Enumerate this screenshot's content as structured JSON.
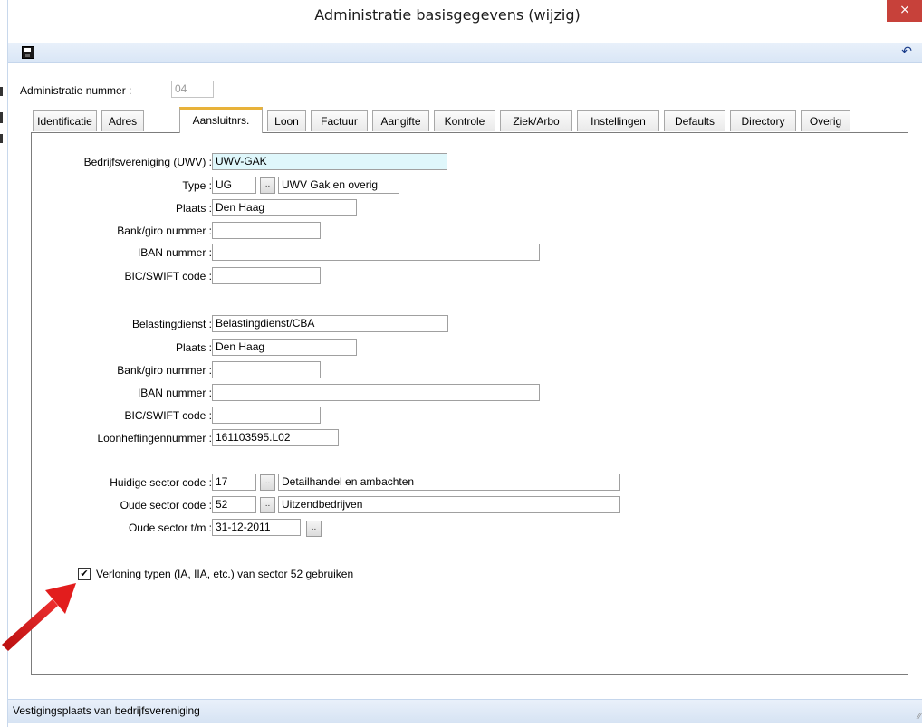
{
  "window": {
    "title": "Administratie basisgegevens  (wijzig)",
    "close_glyph": "×"
  },
  "toolbar": {
    "save_icon": "save-icon",
    "undo_icon": "undo-icon",
    "undo_glyph": "↶"
  },
  "admin": {
    "label": "Administratie nummer :",
    "value": "04"
  },
  "tabs": [
    {
      "label": "Identificatie"
    },
    {
      "label": "Adres"
    },
    {
      "label": "Aansluitnrs."
    },
    {
      "label": "Loon"
    },
    {
      "label": "Factuur"
    },
    {
      "label": "Aangifte"
    },
    {
      "label": "Kontrole"
    },
    {
      "label": "Ziek/Arbo"
    },
    {
      "label": "Instellingen"
    },
    {
      "label": "Defaults"
    },
    {
      "label": "Directory"
    },
    {
      "label": "Overig"
    }
  ],
  "active_tab": "Aansluitnrs.",
  "uwv": {
    "bedrijfsvereniging": {
      "label": "Bedrijfsvereniging (UWV) :",
      "value": "UWV-GAK"
    },
    "type": {
      "label": "Type :",
      "code": "UG",
      "description": "UWV Gak en overig"
    },
    "plaats": {
      "label": "Plaats :",
      "value": "Den Haag"
    },
    "bank": {
      "label": "Bank/giro nummer :",
      "value": ""
    },
    "iban": {
      "label": "IBAN nummer :",
      "value": ""
    },
    "bic": {
      "label": "BIC/SWIFT code :",
      "value": ""
    }
  },
  "belasting": {
    "dienst": {
      "label": "Belastingdienst :",
      "value": "Belastingdienst/CBA"
    },
    "plaats": {
      "label": "Plaats :",
      "value": "Den Haag"
    },
    "bank": {
      "label": "Bank/giro nummer :",
      "value": ""
    },
    "iban": {
      "label": "IBAN nummer :",
      "value": ""
    },
    "bic": {
      "label": "BIC/SWIFT code :",
      "value": ""
    },
    "loonheffing": {
      "label": "Loonheffingennummer :",
      "value": "161103595.L02"
    }
  },
  "sector": {
    "huidige": {
      "label": "Huidige sector code :",
      "code": "17",
      "description": "Detailhandel en ambachten"
    },
    "oude": {
      "label": "Oude sector code :",
      "code": "52",
      "description": "Uitzendbedrijven"
    },
    "tm": {
      "label": "Oude sector t/m :",
      "value": "31-12-2011"
    }
  },
  "dots_label": "..",
  "checkbox": {
    "label": "Verloning typen (IA, IIA, etc.) van sector 52 gebruiken",
    "checked": true,
    "glyph": "✔"
  },
  "status": {
    "text": "Vestigingsplaats van bedrijfsvereniging",
    "grip": "⁄⁄"
  },
  "colors": {
    "arrow": "#e21d1d",
    "active_tab_accent": "#e8b23a",
    "highlight_field": "#dff7fb",
    "close_button": "#c7413a"
  }
}
